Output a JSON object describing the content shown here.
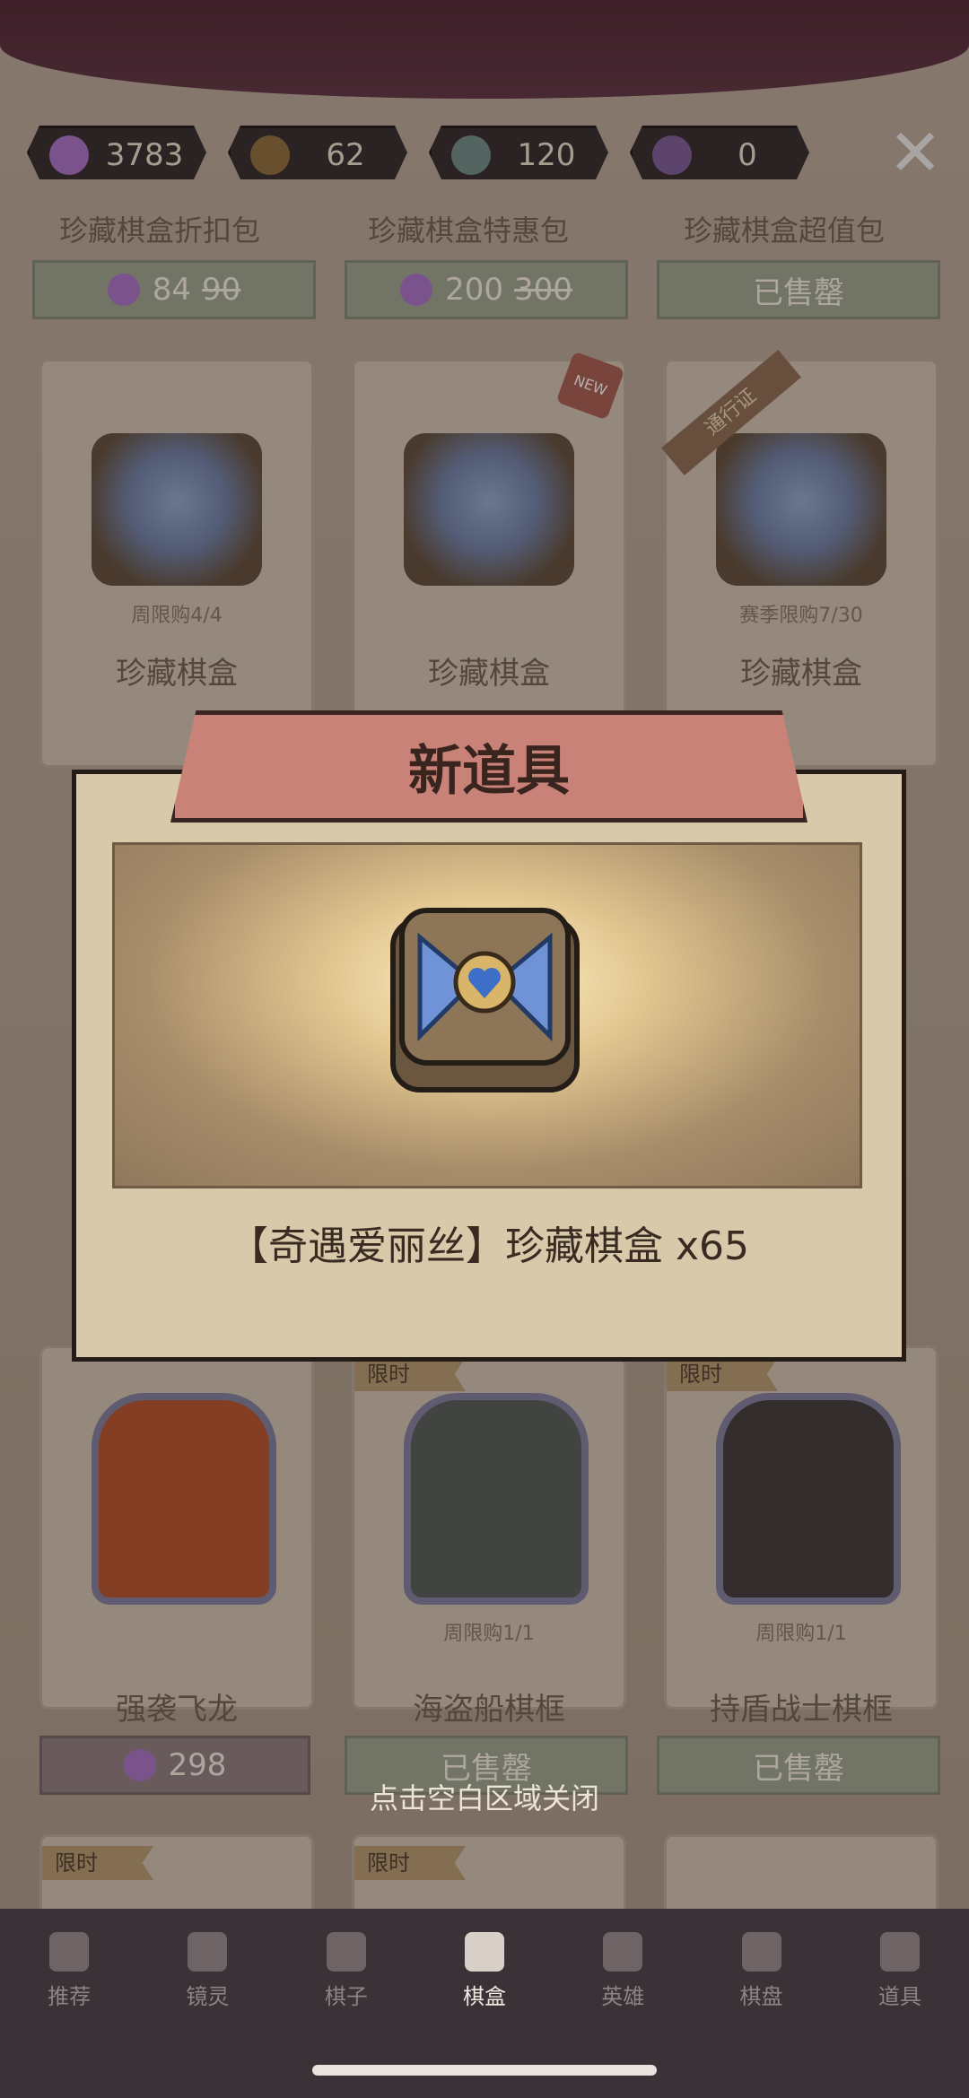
{
  "currencies": [
    {
      "icon": "candy-plus-icon",
      "value": "3783"
    },
    {
      "icon": "pumpkin-coin-icon",
      "value": "62"
    },
    {
      "icon": "potion-icon",
      "value": "120"
    },
    {
      "icon": "purple-gem-icon",
      "value": "0"
    }
  ],
  "top_row": [
    {
      "label": "珍藏棋盒折扣包",
      "price": "84",
      "old_price": "90",
      "sold": ""
    },
    {
      "label": "珍藏棋盒特惠包",
      "price": "200",
      "old_price": "300",
      "sold": ""
    },
    {
      "label": "珍藏棋盒超值包",
      "price": "",
      "old_price": "",
      "sold": "已售罄"
    }
  ],
  "pack_row": [
    {
      "title": "珍藏棋盒",
      "limit": "周限购4/4",
      "badge": ""
    },
    {
      "title": "珍藏棋盒",
      "limit": "",
      "badge": "NEW"
    },
    {
      "title": "珍藏棋盒",
      "limit": "赛季限购7/30",
      "badge": "通行证"
    }
  ],
  "frame_row": [
    {
      "title": "强袭飞龙",
      "limit": "",
      "price": "298",
      "tag": ""
    },
    {
      "title": "海盗船棋框",
      "limit": "周限购1/1",
      "price": "",
      "sold": "已售罄",
      "tag": "限时"
    },
    {
      "title": "持盾战士棋框",
      "limit": "周限购1/1",
      "price": "",
      "sold": "已售罄",
      "tag": "限时"
    }
  ],
  "bottom_tags": [
    "限时",
    "限时"
  ],
  "modal": {
    "banner": "新道具",
    "item_name": "【奇遇爱丽丝】珍藏棋盒 x65",
    "pack_logo": "奇遇爱丽丝"
  },
  "hint": "点击空白区域关闭",
  "nav": [
    {
      "label": "推荐",
      "icon": "star-icon"
    },
    {
      "label": "镜灵",
      "icon": "spirit-icon"
    },
    {
      "label": "棋子",
      "icon": "chess-piece-icon"
    },
    {
      "label": "棋盒",
      "icon": "chess-box-icon"
    },
    {
      "label": "英雄",
      "icon": "hero-icon"
    },
    {
      "label": "棋盘",
      "icon": "board-icon"
    },
    {
      "label": "道具",
      "icon": "item-icon"
    }
  ]
}
